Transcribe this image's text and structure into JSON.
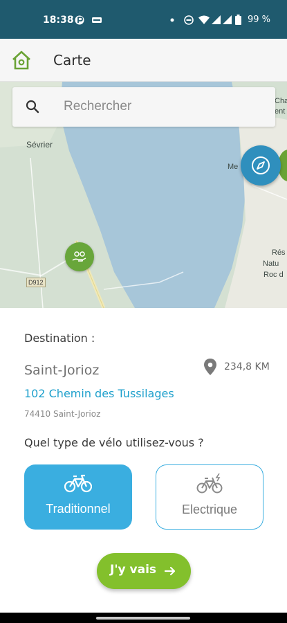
{
  "status_bar": {
    "time": "18:38",
    "battery_percent": "99 %"
  },
  "app_bar": {
    "title": "Carte",
    "home_icon": "home-icon"
  },
  "search": {
    "placeholder": "Rechercher",
    "icon": "search-icon"
  },
  "map": {
    "place_labels": [
      "Sévrier",
      "Me",
      "Cha",
      "ent",
      "Rés",
      "Natu",
      "Roc d"
    ],
    "road_label": "D912",
    "compass_icon": "compass-icon",
    "poi_icon": "bike-hand-icon"
  },
  "destination": {
    "heading": "Destination :",
    "city": "Saint-Jorioz",
    "distance": "234,8 KM",
    "address": "102 Chemin des Tussilages",
    "postal": "74410 Saint-Jorioz"
  },
  "bike_type": {
    "question": "Quel type de vélo utilisez-vous ?",
    "options": [
      {
        "label": "Traditionnel",
        "selected": true,
        "icon": "bicycle-icon"
      },
      {
        "label": "Electrique",
        "selected": false,
        "icon": "electric-bicycle-icon"
      }
    ]
  },
  "action": {
    "go_label": "J'y vais",
    "arrow_icon": "arrow-right-icon"
  },
  "colors": {
    "status_bar": "#1f5a6e",
    "accent_blue": "#3aaee0",
    "link_blue": "#1ea0cc",
    "go_green": "#83c02c",
    "poi_green": "#68a63a"
  }
}
